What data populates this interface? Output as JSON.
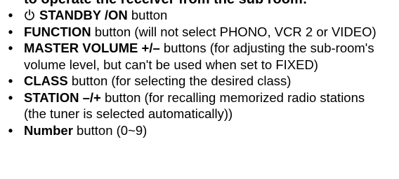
{
  "heading": "to operate the receiver from the sub room:",
  "bullet_glyph": "•",
  "items": [
    {
      "icon": "power-standby-icon",
      "name": "STANDBY /ON",
      "desc": " button"
    },
    {
      "name": "FUNCTION",
      "desc": " button (will not select PHONO, VCR 2 or VIDEO)"
    },
    {
      "name": "MASTER VOLUME +/–",
      "desc": " buttons (for adjusting the sub-room's volume level, but can't be used when set to FIXED)"
    },
    {
      "name": "CLASS",
      "desc": " button (for selecting the desired class)"
    },
    {
      "name": "STATION –/+",
      "desc": " button (for recalling memorized radio stations (the tuner is selected automatically))"
    },
    {
      "name": "Number",
      "desc": " button (0~9)"
    }
  ]
}
